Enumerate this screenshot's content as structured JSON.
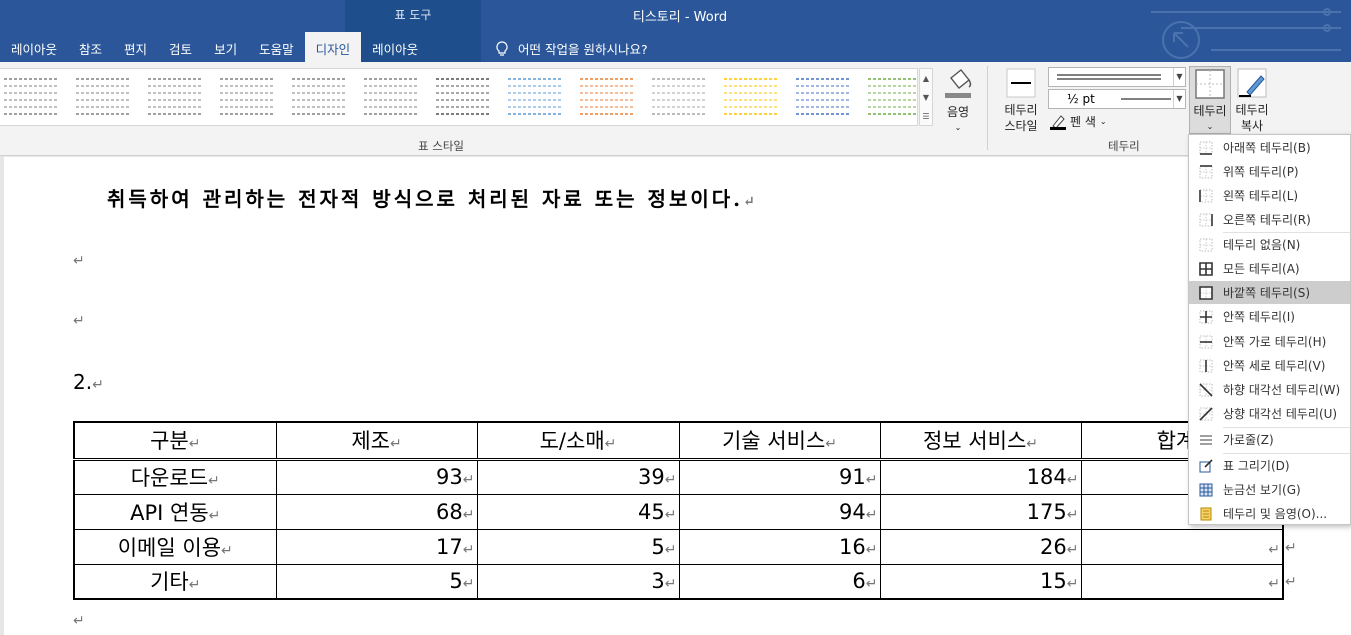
{
  "titlebar": {
    "context_group": "표 도구",
    "doc_title": "티스토리  -  Word",
    "tabs": [
      {
        "label": "레이아웃"
      },
      {
        "label": "참조"
      },
      {
        "label": "편지"
      },
      {
        "label": "검토"
      },
      {
        "label": "보기"
      },
      {
        "label": "도움말"
      },
      {
        "label": "디자인"
      },
      {
        "label": "레이아웃"
      }
    ],
    "active_tab": "디자인",
    "tell_me": "어떤 작업을 원하시나요?"
  },
  "ribbon": {
    "table_styles_label": "표 스타일",
    "shading_label": "음영",
    "border_styles_label": [
      "테두리",
      "스타일"
    ],
    "pen_weight": "½ pt",
    "pen_color_label": "펜 색",
    "borders_button": "테두리",
    "border_painter": [
      "테두리",
      "복사"
    ],
    "borders_group_label": "테두리",
    "style_colors": [
      "#808080",
      "#808080",
      "#808080",
      "#808080",
      "#808080",
      "#808080",
      "#505050",
      "#5b9bd5",
      "#ed7d31",
      "#a5a5a5",
      "#ffc000",
      "#4472c4",
      "#70ad47"
    ]
  },
  "document": {
    "heading_text": "취득하여 관리하는 전자적 방식으로 처리된 자료 또는 정보이다.",
    "para_mark": "↵",
    "section_number": "2.",
    "table": {
      "headers": [
        "구분",
        "제조",
        "도/소매",
        "기술 서비스",
        "정보 서비스",
        "합계"
      ],
      "rows": [
        [
          "다운로드",
          "93",
          "39",
          "91",
          "184",
          ""
        ],
        [
          "API 연동",
          "68",
          "45",
          "94",
          "175",
          ""
        ],
        [
          "이메일 이용",
          "17",
          "5",
          "16",
          "26",
          ""
        ],
        [
          "기타",
          "5",
          "3",
          "6",
          "15",
          ""
        ]
      ]
    }
  },
  "border_menu": {
    "items": [
      {
        "label": "아래쪽 테두리(B)",
        "icon": "bottom-border-icon"
      },
      {
        "label": "위쪽 테두리(P)",
        "icon": "top-border-icon"
      },
      {
        "label": "왼쪽 테두리(L)",
        "icon": "left-border-icon"
      },
      {
        "label": "오른쪽 테두리(R)",
        "icon": "right-border-icon"
      },
      {
        "label": "테두리 없음(N)",
        "icon": "no-border-icon"
      },
      {
        "label": "모든 테두리(A)",
        "icon": "all-borders-icon"
      },
      {
        "label": "바깥쪽 테두리(S)",
        "icon": "outside-borders-icon"
      },
      {
        "label": "안쪽 테두리(I)",
        "icon": "inside-borders-icon"
      },
      {
        "label": "안쪽 가로 테두리(H)",
        "icon": "inside-horizontal-border-icon"
      },
      {
        "label": "안쪽 세로 테두리(V)",
        "icon": "inside-vertical-border-icon"
      },
      {
        "label": "하향 대각선 테두리(W)",
        "icon": "diagonal-down-border-icon"
      },
      {
        "label": "상향 대각선 테두리(U)",
        "icon": "diagonal-up-border-icon"
      },
      {
        "label": "가로줄(Z)",
        "icon": "horizontal-line-icon"
      },
      {
        "label": "표 그리기(D)",
        "icon": "draw-table-icon"
      },
      {
        "label": "눈금선 보기(G)",
        "icon": "view-gridlines-icon"
      },
      {
        "label": "테두리 및 음영(O)...",
        "icon": "borders-and-shading-icon"
      }
    ],
    "highlighted": "바깥쪽 테두리(S)"
  }
}
